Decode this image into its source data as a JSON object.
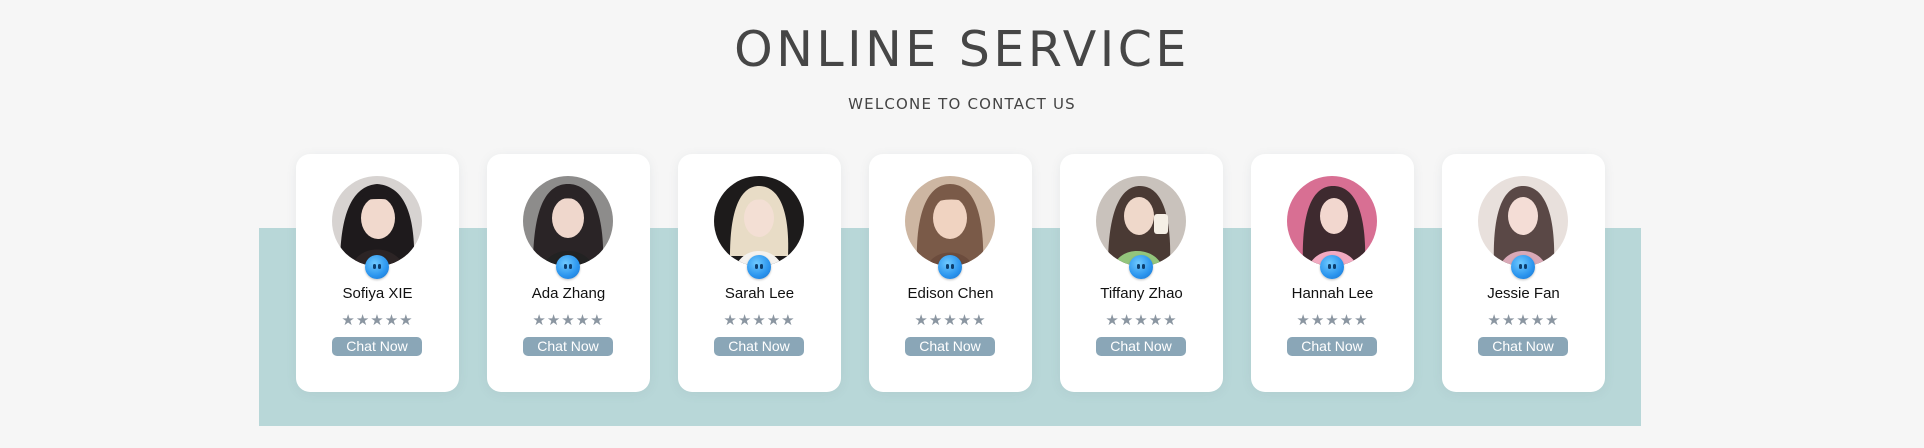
{
  "header": {
    "title": "ONLINE SERVICE",
    "subtitle": "WELCONE TO CONTACT US"
  },
  "colors": {
    "band": "#b8d7d8",
    "chat_button": "#8aa6b7",
    "stars": "#8b96a1"
  },
  "agents": [
    {
      "name": "Sofiya XIE",
      "rating": "★★★★★",
      "button": "Chat Now",
      "badge_icon": "blue-chat-mascot-icon",
      "avatar_color": "#1e1a1c"
    },
    {
      "name": "Ada Zhang",
      "rating": "★★★★★",
      "button": "Chat Now",
      "badge_icon": "blue-chat-mascot-icon",
      "avatar_color": "#2a2426"
    },
    {
      "name": "Sarah Lee",
      "rating": "★★★★★",
      "button": "Chat Now",
      "badge_icon": "blue-chat-mascot-icon",
      "avatar_color": "#1d1b1b"
    },
    {
      "name": "Edison Chen",
      "rating": "★★★★★",
      "button": "Chat Now",
      "badge_icon": "blue-chat-mascot-icon",
      "avatar_color": "#7a5a48"
    },
    {
      "name": "Tiffany Zhao",
      "rating": "★★★★★",
      "button": "Chat Now",
      "badge_icon": "blue-chat-mascot-icon",
      "avatar_color": "#4a3a34"
    },
    {
      "name": "Hannah Lee",
      "rating": "★★★★★",
      "button": "Chat Now",
      "badge_icon": "blue-chat-mascot-icon",
      "avatar_color": "#3e2a2f"
    },
    {
      "name": "Jessie Fan",
      "rating": "★★★★★",
      "button": "Chat Now",
      "badge_icon": "blue-chat-mascot-icon",
      "avatar_color": "#5a4846"
    }
  ]
}
